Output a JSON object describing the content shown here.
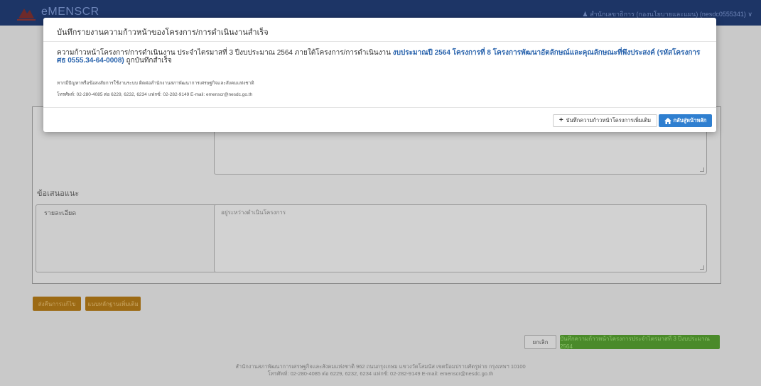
{
  "navbar": {
    "brand": "eMENSCR",
    "user": "สำนักเลขาธิการ (กองนโยบายและแผน) (nesdc0555341)",
    "user_icon": "user-icon",
    "caret_icon": "chevron-down-icon"
  },
  "background": {
    "section_title": "ข้อเสนอแนะ",
    "detail_label": "รายละเอียด",
    "detail_value": "อยู่ระหว่างดำเนินโครงการ",
    "btn_left_1": "ส่งคืนการแก้ไข",
    "btn_left_2": "แนบหลักฐานเพิ่มเติม",
    "btn_cancel": "ยกเลิก",
    "btn_save": "บันทึกความก้าวหน้าโครงการประจำไตรมาสที่ 3 ปีงบประมาณ 2564"
  },
  "footer": {
    "line1": "สำนักงานสภาพัฒนาการเศรษฐกิจและสังคมแห่งชาติ 962 ถนนกรุงเกษม แขวงวัดโสมนัส เขตป้อมปราบศัตรูพ่าย กรุงเทพฯ 10100",
    "line2": "โทรศัพท์: 02-280-4085 ต่อ 6229, 6232, 6234 แฟกซ์: 02-282-9149 E-mail: emenscr@nesdc.go.th"
  },
  "modal": {
    "title": "บันทึกรายงานความก้าวหน้าของโครงการ/การดำเนินงานสำเร็จ",
    "message_prefix": "ความก้าวหน้าโครงการ/การดำเนินงาน ประจำไตรมาสที่  3 ปีงบประมาณ 2564 ภายใต้โครงการ/การดำเนินงาน ",
    "message_highlight": "งบประมาณปี 2564 โครงการที่ 8 โครงการพัฒนาอัตลักษณ์และคุณลักษณะที่พึงประสงค์ (รหัสโครงการ ศธ 0555.34-64-0008)",
    "message_suffix": " ถูกบันทึกสำเร็จ",
    "help_line1": "หากมีปัญหาหรือข้อสงสัยการใช้งานระบบ ติดต่อสำนักงานสภาพัฒนาการเศรษฐกิจและสังคมแห่งชาติ",
    "help_line2": "โทรศัพท์: 02-280-4085 ต่อ 6229, 6232, 6234 แฟกซ์: 02-282-9149 E-mail: emenscr@nesdc.go.th",
    "btn_add_label": "บันทึกความก้าวหน้าโครงการเพิ่มเติม",
    "btn_home_label": "กลับสู่หน้าหลัก",
    "btn_add_icon": "plus-icon",
    "btn_home_icon": "home-icon"
  },
  "colors": {
    "navbar": "#1d3566",
    "modal_highlight": "#2a64ad",
    "btn_primary": "#2f7fd0",
    "btn_orange": "#9c6a14",
    "btn_green": "#4a8a2a"
  }
}
